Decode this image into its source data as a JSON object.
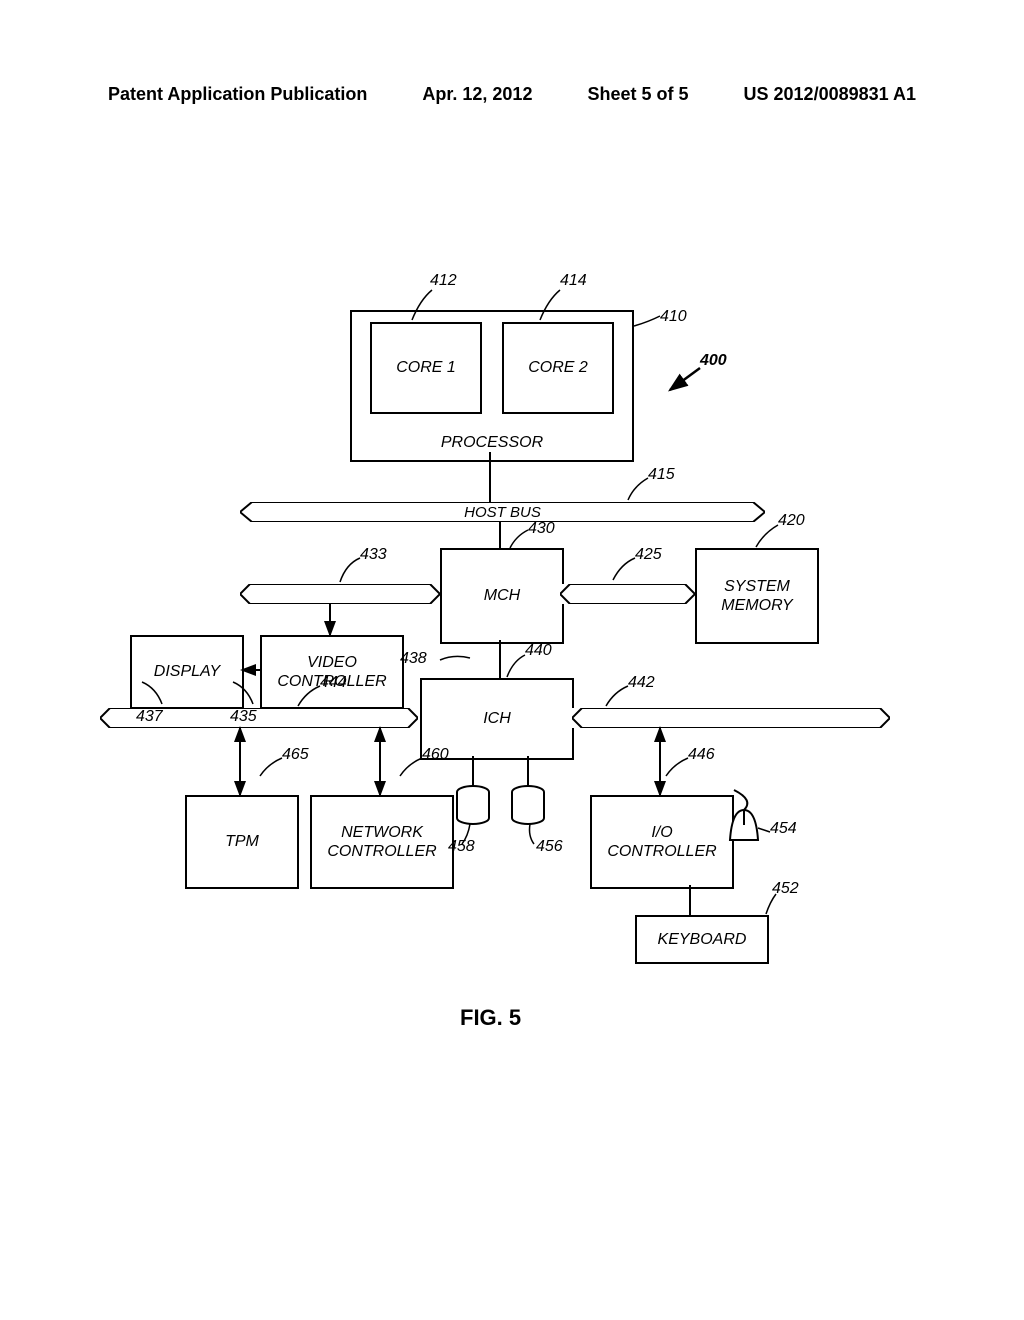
{
  "doc": {
    "publication": "Patent Application Publication",
    "date": "Apr. 12, 2012",
    "sheet": "Sheet 5 of 5",
    "pubno": "US 2012/0089831 A1"
  },
  "fig": {
    "caption": "FIG. 5"
  },
  "blocks": {
    "processor": "PROCESSOR",
    "core1": "CORE 1",
    "core2": "CORE 2",
    "hostbus": "HOST BUS",
    "mch": "MCH",
    "sysmem": "SYSTEM\nMEMORY",
    "video": "VIDEO\nCONTROLLER",
    "display": "DISPLAY",
    "ich": "ICH",
    "tpm": "TPM",
    "netctrl": "NETWORK\nCONTROLLER",
    "ioctrl": "I/O\nCONTROLLER",
    "keyboard": "KEYBOARD"
  },
  "refs": {
    "r400": "400",
    "r410": "410",
    "r412": "412",
    "r414": "414",
    "r415": "415",
    "r420": "420",
    "r425": "425",
    "r430": "430",
    "r433": "433",
    "r435": "435",
    "r437": "437",
    "r438": "438",
    "r440": "440",
    "r442": "442",
    "r444": "444",
    "r446": "446",
    "r452": "452",
    "r454": "454",
    "r456": "456",
    "r458": "458",
    "r460": "460",
    "r465": "465"
  }
}
